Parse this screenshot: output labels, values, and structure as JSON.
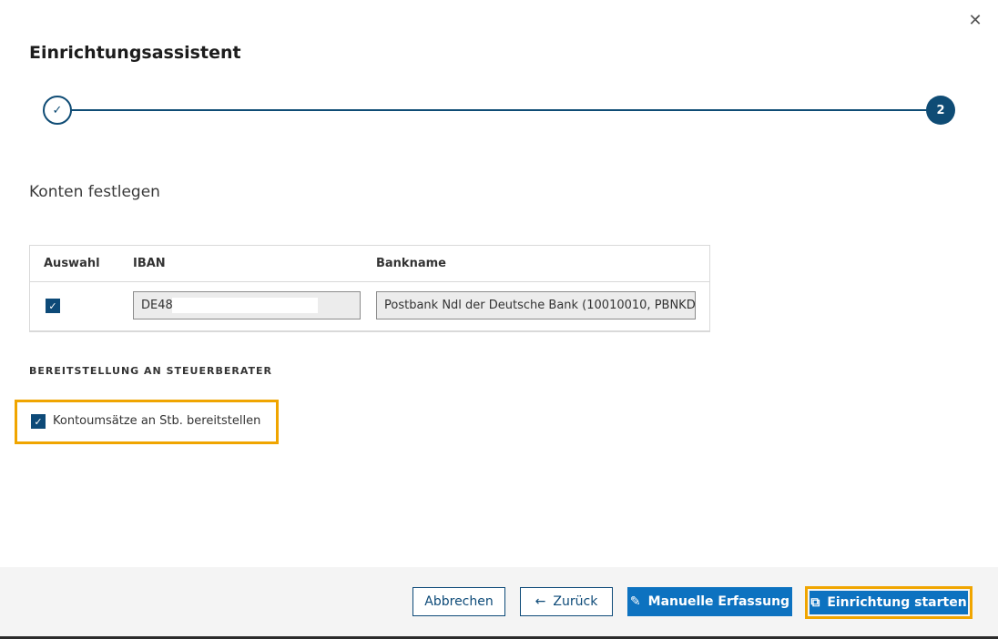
{
  "dialog": {
    "title": "Einrichtungsassistent",
    "close_icon": "close-icon"
  },
  "stepper": {
    "steps": [
      {
        "label": "✓",
        "state": "done"
      },
      {
        "label": "2",
        "state": "active"
      }
    ]
  },
  "section": {
    "title": "Konten festlegen"
  },
  "table": {
    "headers": [
      "Auswahl",
      "IBAN",
      "Bankname"
    ],
    "rows": [
      {
        "selected": true,
        "iban": "DE48",
        "bankname": "Postbank Ndl der Deutsche Bank (10010010, PBNKD..."
      }
    ]
  },
  "provision": {
    "heading": "BEREITSTELLUNG AN STEUERBERATER",
    "checkbox_label": "Kontoumsätze an Stb. bereitstellen",
    "checked": true
  },
  "footer": {
    "cancel_label": "Abbrechen",
    "back_label": "Zurück",
    "manual_label": "Manuelle Erfassung",
    "start_label": "Einrichtung starten"
  },
  "colors": {
    "primary": "#0d72c0",
    "dark_blue": "#0f4c75",
    "highlight": "#f0a500"
  }
}
